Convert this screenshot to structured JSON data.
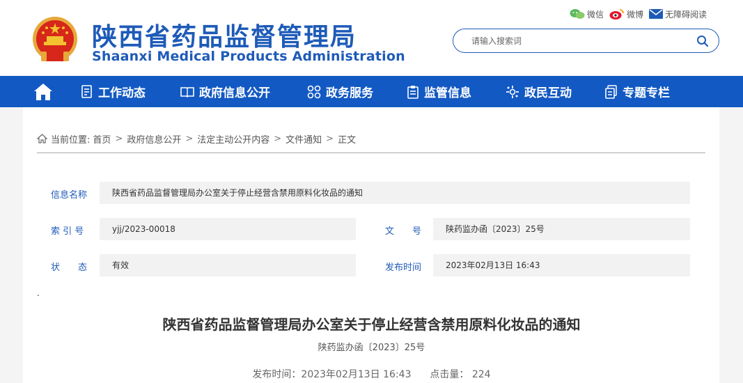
{
  "header": {
    "title_cn": "陕西省药品监督管理局",
    "title_en": "Shaanxi Medical Products Administration",
    "emblem_icon": "national-emblem-icon",
    "top_links": [
      {
        "label": "微信",
        "icon": "wechat-icon"
      },
      {
        "label": "微博",
        "icon": "weibo-icon"
      },
      {
        "label": "无障碍阅读",
        "icon": "accessibility-mail-icon"
      }
    ],
    "search": {
      "placeholder": "请输入搜索词",
      "value": ""
    }
  },
  "nav": {
    "home_icon": "home-icon",
    "items": [
      {
        "label": "工作动态",
        "icon": "document-list-icon"
      },
      {
        "label": "政府信息公开",
        "icon": "open-book-icon"
      },
      {
        "label": "政务服务",
        "icon": "grid-circles-icon"
      },
      {
        "label": "监管信息",
        "icon": "clipboard-icon"
      },
      {
        "label": "政民互动",
        "icon": "interaction-icon"
      },
      {
        "label": "专题专栏",
        "icon": "folder-pages-icon"
      }
    ]
  },
  "breadcrumb": {
    "prefix": "当前位置:",
    "items": [
      "首页",
      "政府信息公开",
      "法定主动公开内容",
      "文件通知",
      "正文"
    ]
  },
  "meta": {
    "name_label": "信息名称",
    "name_value": "陕西省药品监督管理局办公室关于停止经营含禁用原料化妆品的通知",
    "index_label": "索 引 号",
    "index_value": "yjj/2023-00018",
    "docno_label": "文　　号",
    "docno_value": "陕药监办函〔2023〕25号",
    "status_label": "状　　态",
    "status_value": "有效",
    "date_label": "发布时间",
    "date_value": "2023年02月13日 16:43"
  },
  "article": {
    "stray_mark": ".",
    "title": "陕西省药品监督管理局办公室关于停止经营含禁用原料化妆品的通知",
    "doc_number": "陕药监办函〔2023〕25号",
    "publish_label": "发布时间：2023年02月13日 16:43",
    "hits_label": "点击量：",
    "hits_value": "224"
  },
  "colors": {
    "brand_blue": "#1e5bb8",
    "nav_blue": "#1259c3",
    "emblem_red": "#d7261a",
    "emblem_gold": "#f2c230"
  }
}
